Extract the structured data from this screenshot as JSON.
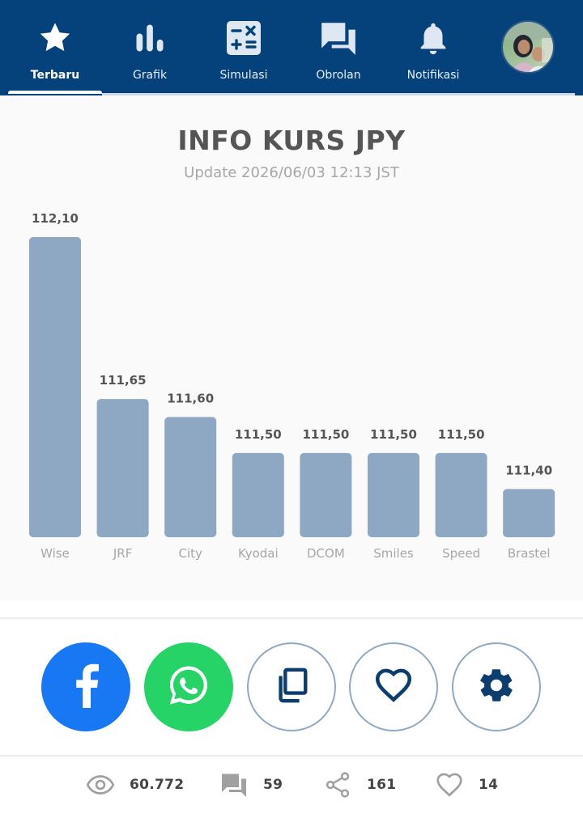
{
  "nav": {
    "items": [
      {
        "label": "Terbaru",
        "icon": "star-icon",
        "active": true
      },
      {
        "label": "Grafik",
        "icon": "bar-chart-icon",
        "active": false
      },
      {
        "label": "Simulasi",
        "icon": "calculator-icon",
        "active": false
      },
      {
        "label": "Obrolan",
        "icon": "chat-icon",
        "active": false
      },
      {
        "label": "Notifikasi",
        "icon": "bell-icon",
        "active": false
      }
    ],
    "avatar_icon": "profile-photo"
  },
  "card": {
    "title": "INFO KURS JPY",
    "subtitle": "Update 2026/06/03 12:13 JST"
  },
  "chart_data": {
    "type": "bar",
    "categories": [
      "Wise",
      "JRF",
      "City",
      "Kyodai",
      "DCOM",
      "Smiles",
      "Speed",
      "Brastel"
    ],
    "values": [
      112.1,
      111.65,
      111.6,
      111.5,
      111.5,
      111.5,
      111.5,
      111.4
    ],
    "value_labels": [
      "112,10",
      "111,65",
      "111,60",
      "111,50",
      "111,50",
      "111,50",
      "111,50",
      "111,40"
    ],
    "ylim": [
      111.275,
      112.1
    ],
    "bar_color": "#8ea8c3",
    "grid": false
  },
  "share": {
    "buttons": [
      {
        "name": "facebook",
        "icon": "facebook-icon",
        "color": "#1877f2"
      },
      {
        "name": "whatsapp",
        "icon": "whatsapp-icon",
        "color": "#25d366"
      },
      {
        "name": "copy",
        "icon": "copy-icon"
      },
      {
        "name": "like",
        "icon": "heart-icon"
      },
      {
        "name": "settings",
        "icon": "gear-icon"
      }
    ]
  },
  "stats": {
    "views": "60.772",
    "comments": "59",
    "shares": "161",
    "likes": "14"
  },
  "colors": {
    "brand": "#05417b",
    "icon_dark": "#0b3d6e",
    "muted": "#a0a0a0"
  }
}
